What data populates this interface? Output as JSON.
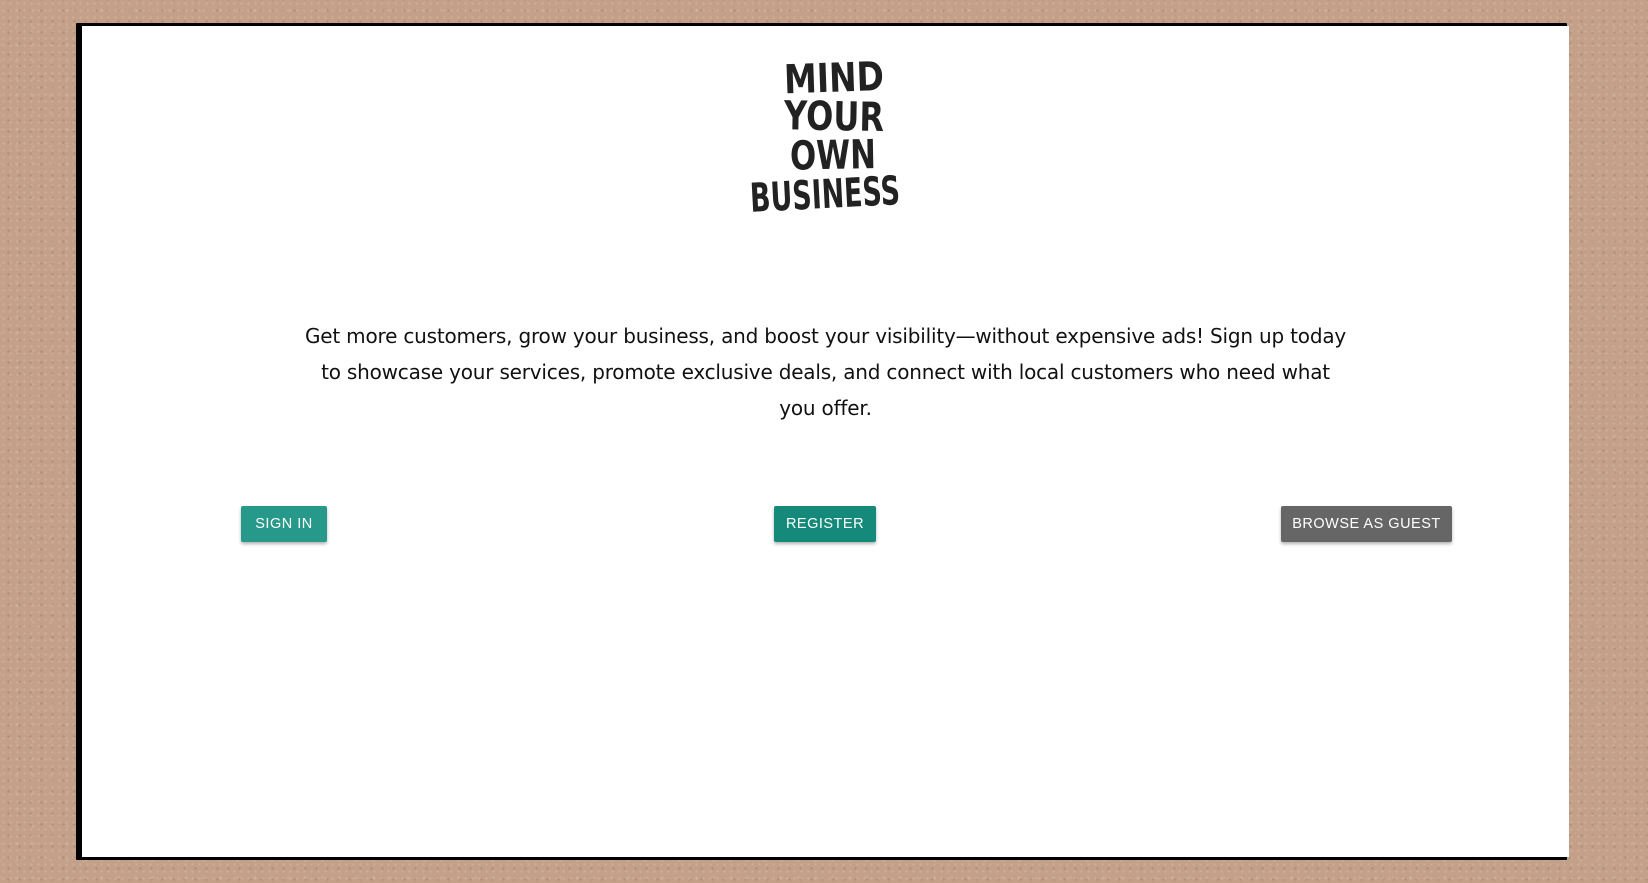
{
  "logo": {
    "lines": [
      "MIND",
      "YOUR",
      "OWN",
      "BUSINESS"
    ]
  },
  "blurb": {
    "text": "Get more customers, grow your business, and boost your visibility—without expensive ads! Sign up today to showcase your services, promote exclusive deals, and connect with local customers who need what you offer."
  },
  "actions": {
    "sign_in": "SIGN IN",
    "register": "REGISTER",
    "browse_guest": "BROWSE AS GUEST"
  },
  "colors": {
    "sign_in": "#26998a",
    "register": "#15897a",
    "browse_guest": "#666666",
    "background": "#c4a088"
  }
}
